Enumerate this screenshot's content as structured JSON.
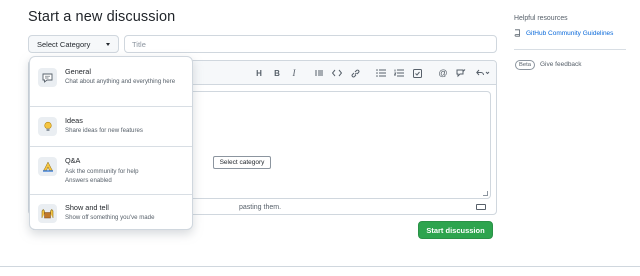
{
  "page": {
    "title": "Start a new discussion"
  },
  "form": {
    "category_button": "Select Category",
    "title_placeholder": "Title",
    "attach_text": "pasting them.",
    "tooltip": "Select category",
    "submit_label": "Start discussion"
  },
  "toolbar": {
    "icons": [
      "heading-icon",
      "bold-icon",
      "italic-icon",
      "quote-icon",
      "code-icon",
      "link-icon",
      "bulleted-list-icon",
      "numbered-list-icon",
      "task-list-icon",
      "mention-icon",
      "reference-icon",
      "undo-icon"
    ]
  },
  "dropdown": {
    "items": [
      {
        "name": "General",
        "description": "Chat about anything and everything here",
        "icon": "speech-bubble-icon"
      },
      {
        "name": "Ideas",
        "description": "Share ideas for new features",
        "icon": "lightbulb-icon"
      },
      {
        "name": "Q&A",
        "description": "Ask the community for help",
        "extra": "Answers enabled",
        "icon": "pray-icon"
      },
      {
        "name": "Show and tell",
        "description": "Show off something you've made",
        "icon": "raised-hands-icon"
      }
    ]
  },
  "sidebar": {
    "heading": "Helpful resources",
    "link": "GitHub Community Guidelines",
    "beta": "Beta",
    "feedback": "Give feedback"
  },
  "colors": {
    "accent_green": "#2da44e",
    "link_blue": "#0969da",
    "border": "#d0d7de"
  }
}
